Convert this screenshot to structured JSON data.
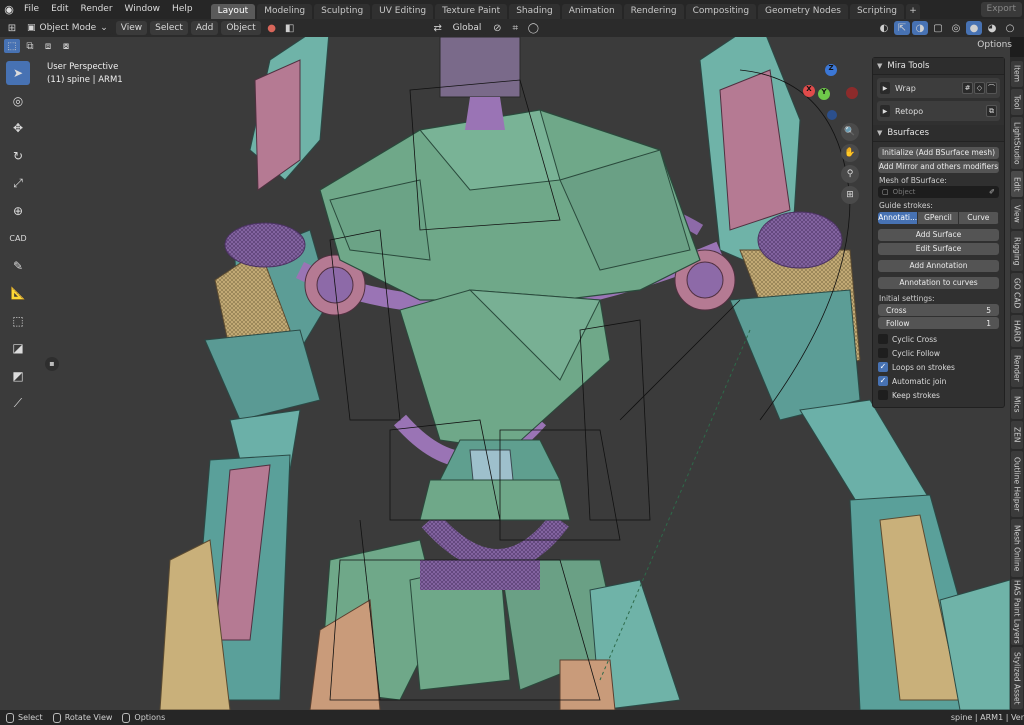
{
  "topbar": {
    "menus": [
      "File",
      "Edit",
      "Render",
      "Window",
      "Help"
    ],
    "tabs": [
      "Layout",
      "Modeling",
      "Sculpting",
      "UV Editing",
      "Texture Paint",
      "Shading",
      "Animation",
      "Rendering",
      "Compositing",
      "Geometry Nodes",
      "Scripting"
    ],
    "active_tab": "Layout",
    "add_tab": "+",
    "export": "Export"
  },
  "header": {
    "mode": "Object Mode",
    "view": "View",
    "select": "Select",
    "add": "Add",
    "object": "Object",
    "orientation": "Global",
    "options": "Options"
  },
  "viewport": {
    "perspective": "User Perspective",
    "object_info": "(11) spine | ARM1"
  },
  "gizmo": {
    "z": "Z",
    "y": "Y",
    "x": "X"
  },
  "side_tabs": [
    "Item",
    "Tool",
    "LightStudio",
    "Edit",
    "View",
    "Rigging",
    "GO CAD",
    "HARD",
    "Render",
    "Mics",
    "ZEN",
    "Outline Helper",
    "Mesh Online",
    "HAS Paint Layers",
    "Stylized Asset"
  ],
  "panel": {
    "mira_title": "Mira Tools",
    "wrap": "Wrap",
    "retopo": "Retopo",
    "bsurfaces_title": "Bsurfaces",
    "initialize": "Initialize (Add BSurface mesh)",
    "add_mirror": "Add Mirror and others modifiers",
    "mesh_label": "Mesh of BSurface:",
    "object_placeholder": "Object",
    "guide_label": "Guide strokes:",
    "guide_options": [
      "Annotati...",
      "GPencil",
      "Curve"
    ],
    "add_surface": "Add Surface",
    "edit_surface": "Edit Surface",
    "add_annotation": "Add Annotation",
    "annotation_to_curves": "Annotation to curves",
    "initial_label": "Initial settings:",
    "cross_label": "Cross",
    "cross_value": "5",
    "follow_label": "Follow",
    "follow_value": "1",
    "checkboxes": [
      {
        "label": "Cyclic Cross",
        "checked": false
      },
      {
        "label": "Cyclic Follow",
        "checked": false
      },
      {
        "label": "Loops on strokes",
        "checked": true
      },
      {
        "label": "Automatic join",
        "checked": true
      },
      {
        "label": "Keep strokes",
        "checked": false
      }
    ]
  },
  "statusbar": {
    "select": "Select",
    "rotate": "Rotate View",
    "options": "Options",
    "right": "spine | ARM1 | Ver"
  },
  "colors": {
    "accent": "#4772b3",
    "armor_teal": "#6fb3a8",
    "armor_green": "#6fa889",
    "armor_purple": "#9a74b5",
    "armor_pink": "#b57a93"
  }
}
